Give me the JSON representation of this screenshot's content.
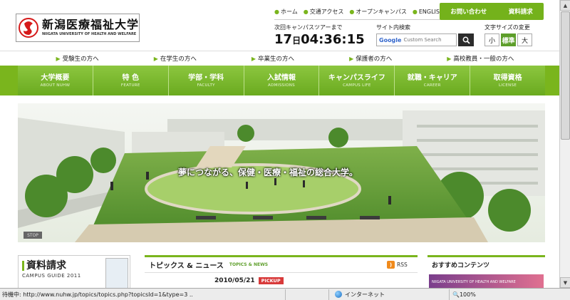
{
  "logo": {
    "jp": "新潟医療福祉大学",
    "en": "NIIGATA UNIVERSITY OF HEALTH AND WELFARE"
  },
  "topnav": [
    {
      "label": "ホーム"
    },
    {
      "label": "交通アクセス"
    },
    {
      "label": "オープンキャンパス"
    },
    {
      "label": "ENGLISH"
    }
  ],
  "contact": {
    "inquiry": "お問い合わせ",
    "request": "資料請求"
  },
  "campus_tour": {
    "label": "次回キャンパスツアーまで",
    "days": "17",
    "day_unit": "日",
    "time": "04:36:15"
  },
  "search": {
    "label": "サイト内検索",
    "google": "Google",
    "placeholder": "Custom Search"
  },
  "font_size": {
    "label": "文字サイズの変更",
    "small": "小",
    "standard": "標準",
    "large": "大",
    "selected": "標準"
  },
  "audience": [
    {
      "label": "受験生の方へ"
    },
    {
      "label": "在学生の方へ"
    },
    {
      "label": "卒業生の方へ"
    },
    {
      "label": "保護者の方へ"
    },
    {
      "label": "高校教員・一般の方へ"
    }
  ],
  "main_nav": [
    {
      "jp": "大学概要",
      "en": "ABOUT NUHW"
    },
    {
      "jp": "特 色",
      "en": "FEATURE"
    },
    {
      "jp": "学部・学科",
      "en": "FACULTY"
    },
    {
      "jp": "入試情報",
      "en": "ADMISSIONS"
    },
    {
      "jp": "キャンパスライフ",
      "en": "CAMPUS LIFE"
    },
    {
      "jp": "就職・キャリア",
      "en": "CAREER"
    },
    {
      "jp": "取得資格",
      "en": "LICENSE"
    }
  ],
  "hero": {
    "caption": "夢につながる、保健・医療・福祉の総合大学。",
    "stop": "STOP"
  },
  "brochure": {
    "title": "資料請求",
    "sub": "CAMPUS GUIDE 2011"
  },
  "topics": {
    "title": "トピックス & ニュース",
    "en": "TOPICS & NEWS",
    "rss": "RSS",
    "date": "2010/05/21",
    "badge": "PICKUP"
  },
  "recommend": {
    "title": "おすすめコンテンツ",
    "banner": "NIIGATA UNIVERSITY OF HEALTH AND WELFARE"
  },
  "status": {
    "text": "待機中: http://www.nuhw.jp/topics/topics.php?topicsId=1&type=3 ...",
    "zone": "インターネット",
    "zoom": "100%"
  },
  "colors": {
    "brand_green": "#7ab51d",
    "nav_green": "#6aaa1f",
    "pickup_red": "#d83a3a",
    "rss_orange": "#f08a1c"
  },
  "icons": {
    "logo": "swirl-logo-icon",
    "search": "search-icon",
    "rss": "rss-icon",
    "globe": "globe-icon",
    "zoom": "zoom-icon"
  }
}
